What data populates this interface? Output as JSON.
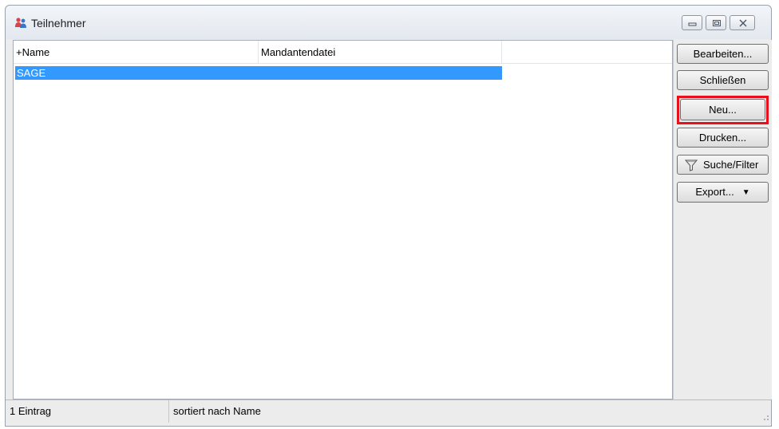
{
  "window": {
    "title": "Teilnehmer",
    "controls": {
      "minimize_icon": "minimize-icon",
      "maximize_icon": "maximize-icon",
      "close_icon": "close-icon"
    }
  },
  "list": {
    "columns": [
      {
        "label": "+Name"
      },
      {
        "label": "Mandantendatei"
      }
    ],
    "rows": [
      {
        "name": "SAGE",
        "mandantendatei": "",
        "selected": true
      }
    ]
  },
  "buttons": {
    "bearbeiten": "Bearbeiten...",
    "schliessen": "Schließen",
    "neu": "Neu...",
    "drucken": "Drucken...",
    "suche_filter": "Suche/Filter",
    "export": "Export...",
    "export_arrow": "▼"
  },
  "statusbar": {
    "count": "1 Eintrag",
    "sort": "sortiert nach Name"
  },
  "colors": {
    "selection": "#3399ff",
    "highlight_border": "#e8101a"
  }
}
